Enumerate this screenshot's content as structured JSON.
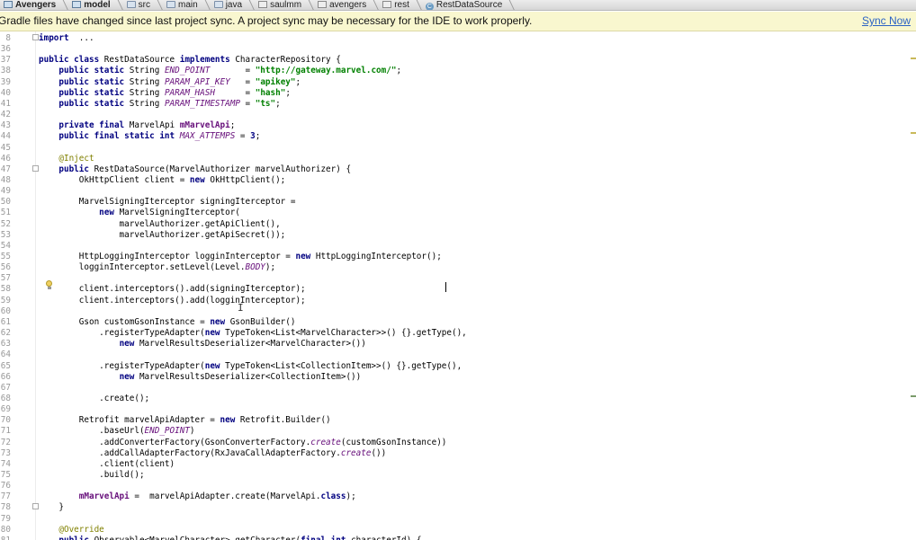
{
  "breadcrumbs": [
    {
      "label": "Avengers",
      "icon": "module-icon",
      "bold": true
    },
    {
      "label": "model",
      "icon": "module-icon",
      "bold": true
    },
    {
      "label": "src",
      "icon": "folder-icon",
      "bold": false
    },
    {
      "label": "main",
      "icon": "folder-icon",
      "bold": false
    },
    {
      "label": "java",
      "icon": "folder-icon",
      "bold": false
    },
    {
      "label": "saulmm",
      "icon": "package-icon",
      "bold": false
    },
    {
      "label": "avengers",
      "icon": "package-icon",
      "bold": false
    },
    {
      "label": "rest",
      "icon": "package-icon",
      "bold": false
    },
    {
      "label": "RestDataSource",
      "icon": "class-icon",
      "bold": false
    }
  ],
  "notification": {
    "message": "Gradle files have changed since last project sync. A project sync may be necessary for the IDE to work properly.",
    "action": "Sync Now"
  },
  "colors": {
    "keyword": "#000080",
    "string": "#008000",
    "field": "#660e7a",
    "annotation": "#808000",
    "notification_bg": "#f9f7cf",
    "link": "#2a62c4"
  },
  "code_lines": [
    {
      "n": "8",
      "tokens": [
        [
          "kw",
          "import"
        ],
        [
          "",
          "  ..."
        ]
      ]
    },
    {
      "n": "36",
      "tokens": []
    },
    {
      "n": "37",
      "tokens": [
        [
          "kw",
          "public class "
        ],
        [
          "",
          "RestDataSource "
        ],
        [
          "kw",
          "implements "
        ],
        [
          "",
          "CharacterRepository {"
        ]
      ]
    },
    {
      "n": "38",
      "tokens": [
        [
          "",
          "    "
        ],
        [
          "kw",
          "public static "
        ],
        [
          "",
          "String "
        ],
        [
          "fld",
          "END_POINT"
        ],
        [
          "",
          "       = "
        ],
        [
          "str",
          "\"http://gateway.marvel.com/\""
        ],
        [
          "",
          ";"
        ]
      ]
    },
    {
      "n": "39",
      "tokens": [
        [
          "",
          "    "
        ],
        [
          "kw",
          "public static "
        ],
        [
          "",
          "String "
        ],
        [
          "fld",
          "PARAM_API_KEY"
        ],
        [
          "",
          "   = "
        ],
        [
          "str",
          "\"apikey\""
        ],
        [
          "",
          ";"
        ]
      ]
    },
    {
      "n": "40",
      "tokens": [
        [
          "",
          "    "
        ],
        [
          "kw",
          "public static "
        ],
        [
          "",
          "String "
        ],
        [
          "fld",
          "PARAM_HASH"
        ],
        [
          "",
          "      = "
        ],
        [
          "str",
          "\"hash\""
        ],
        [
          "",
          ";"
        ]
      ]
    },
    {
      "n": "41",
      "tokens": [
        [
          "",
          "    "
        ],
        [
          "kw",
          "public static "
        ],
        [
          "",
          "String "
        ],
        [
          "fld",
          "PARAM_TIMESTAMP"
        ],
        [
          "",
          " = "
        ],
        [
          "str",
          "\"ts\""
        ],
        [
          "",
          ";"
        ]
      ]
    },
    {
      "n": "42",
      "tokens": []
    },
    {
      "n": "43",
      "tokens": [
        [
          "",
          "    "
        ],
        [
          "kw",
          "private final "
        ],
        [
          "",
          "MarvelApi "
        ],
        [
          "ifld",
          "mMarvelApi"
        ],
        [
          "",
          ";"
        ]
      ]
    },
    {
      "n": "44",
      "tokens": [
        [
          "",
          "    "
        ],
        [
          "kw",
          "public final static int "
        ],
        [
          "fld",
          "MAX_ATTEMPS"
        ],
        [
          "",
          " = "
        ],
        [
          "kw",
          "3"
        ],
        [
          "",
          ";"
        ]
      ]
    },
    {
      "n": "45",
      "tokens": []
    },
    {
      "n": "46",
      "tokens": [
        [
          "",
          "    "
        ],
        [
          "ann",
          "@Inject"
        ]
      ]
    },
    {
      "n": "47",
      "tokens": [
        [
          "",
          "    "
        ],
        [
          "kw",
          "public "
        ],
        [
          "",
          "RestDataSource(MarvelAuthorizer marvelAuthorizer) {"
        ]
      ]
    },
    {
      "n": "48",
      "tokens": [
        [
          "",
          "        OkHttpClient client = "
        ],
        [
          "kw",
          "new "
        ],
        [
          "",
          "OkHttpClient();"
        ]
      ]
    },
    {
      "n": "49",
      "tokens": []
    },
    {
      "n": "50",
      "tokens": [
        [
          "",
          "        MarvelSigningIterceptor signingIterceptor ="
        ]
      ]
    },
    {
      "n": "51",
      "tokens": [
        [
          "",
          "            "
        ],
        [
          "kw",
          "new "
        ],
        [
          "",
          "MarvelSigningIterceptor("
        ]
      ]
    },
    {
      "n": "52",
      "tokens": [
        [
          "",
          "                marvelAuthorizer.getApiClient(),"
        ]
      ]
    },
    {
      "n": "53",
      "tokens": [
        [
          "",
          "                marvelAuthorizer.getApiSecret());"
        ]
      ]
    },
    {
      "n": "54",
      "tokens": []
    },
    {
      "n": "55",
      "tokens": [
        [
          "",
          "        HttpLoggingInterceptor logginInterceptor = "
        ],
        [
          "kw",
          "new "
        ],
        [
          "",
          "HttpLoggingInterceptor();"
        ]
      ]
    },
    {
      "n": "56",
      "tokens": [
        [
          "",
          "        logginInterceptor.setLevel(Level."
        ],
        [
          "fld",
          "BODY"
        ],
        [
          "",
          ");"
        ]
      ]
    },
    {
      "n": "57",
      "tokens": []
    },
    {
      "n": "58",
      "tokens": [
        [
          "",
          "        client.interceptors().add(signingIterceptor);"
        ]
      ]
    },
    {
      "n": "59",
      "tokens": [
        [
          "",
          "        client.interceptors().add(logginInterceptor);"
        ]
      ]
    },
    {
      "n": "60",
      "tokens": []
    },
    {
      "n": "61",
      "tokens": [
        [
          "",
          "        Gson customGsonInstance = "
        ],
        [
          "kw",
          "new "
        ],
        [
          "",
          "GsonBuilder()"
        ]
      ]
    },
    {
      "n": "62",
      "tokens": [
        [
          "",
          "            .registerTypeAdapter("
        ],
        [
          "kw",
          "new "
        ],
        [
          "",
          "TypeToken<List<MarvelCharacter>>() {}.getType(),"
        ]
      ]
    },
    {
      "n": "63",
      "tokens": [
        [
          "",
          "                "
        ],
        [
          "kw",
          "new "
        ],
        [
          "",
          "MarvelResultsDeserializer<MarvelCharacter>())"
        ]
      ]
    },
    {
      "n": "64",
      "tokens": []
    },
    {
      "n": "65",
      "tokens": [
        [
          "",
          "            .registerTypeAdapter("
        ],
        [
          "kw",
          "new "
        ],
        [
          "",
          "TypeToken<List<CollectionItem>>() {}.getType(),"
        ]
      ]
    },
    {
      "n": "66",
      "tokens": [
        [
          "",
          "                "
        ],
        [
          "kw",
          "new "
        ],
        [
          "",
          "MarvelResultsDeserializer<CollectionItem>())"
        ]
      ]
    },
    {
      "n": "67",
      "tokens": []
    },
    {
      "n": "68",
      "tokens": [
        [
          "",
          "            .create();"
        ]
      ]
    },
    {
      "n": "69",
      "tokens": []
    },
    {
      "n": "70",
      "tokens": [
        [
          "",
          "        Retrofit marvelApiAdapter = "
        ],
        [
          "kw",
          "new "
        ],
        [
          "",
          "Retrofit.Builder()"
        ]
      ]
    },
    {
      "n": "71",
      "tokens": [
        [
          "",
          "            .baseUrl("
        ],
        [
          "fld",
          "END_POINT"
        ],
        [
          "",
          ")"
        ]
      ]
    },
    {
      "n": "72",
      "tokens": [
        [
          "",
          "            .addConverterFactory(GsonConverterFactory."
        ],
        [
          "fld",
          "create"
        ],
        [
          "",
          "(customGsonInstance))"
        ]
      ]
    },
    {
      "n": "73",
      "tokens": [
        [
          "",
          "            .addCallAdapterFactory(RxJavaCallAdapterFactory."
        ],
        [
          "fld",
          "create"
        ],
        [
          "",
          "())"
        ]
      ]
    },
    {
      "n": "74",
      "tokens": [
        [
          "",
          "            .client(client)"
        ]
      ]
    },
    {
      "n": "75",
      "tokens": [
        [
          "",
          "            .build();"
        ]
      ]
    },
    {
      "n": "76",
      "tokens": []
    },
    {
      "n": "77",
      "tokens": [
        [
          "",
          "        "
        ],
        [
          "ifld",
          "mMarvelApi"
        ],
        [
          "",
          " =  marvelApiAdapter.create(MarvelApi."
        ],
        [
          "kw",
          "class"
        ],
        [
          "",
          ");"
        ]
      ]
    },
    {
      "n": "78",
      "tokens": [
        [
          "",
          "    }"
        ]
      ]
    },
    {
      "n": "79",
      "tokens": []
    },
    {
      "n": "80",
      "tokens": [
        [
          "",
          "    "
        ],
        [
          "ann",
          "@Override"
        ]
      ]
    },
    {
      "n": "81",
      "tokens": [
        [
          "",
          "    "
        ],
        [
          "kw",
          "public "
        ],
        [
          "",
          "Observable<MarvelCharacter> getCharacter("
        ],
        [
          "kw",
          "final int "
        ],
        [
          "",
          "characterId) {"
        ]
      ]
    }
  ]
}
